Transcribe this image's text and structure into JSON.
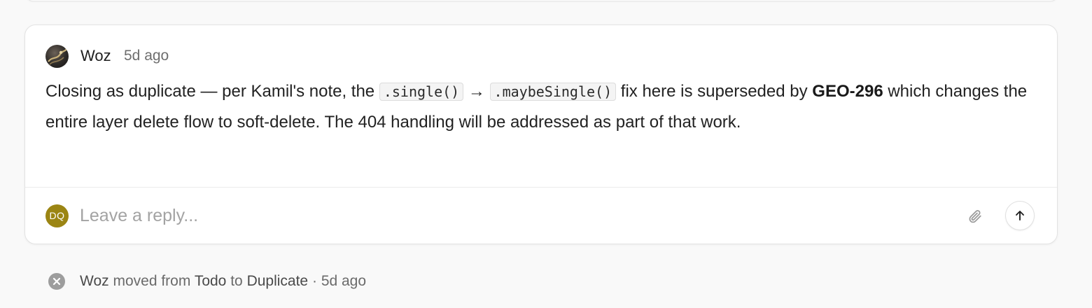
{
  "comment": {
    "author": "Woz",
    "time": "5d ago",
    "body": {
      "text1": "Closing as duplicate — per Kamil's note, the ",
      "code1": ".single()",
      "arrow": " → ",
      "code2": ".maybeSingle()",
      "text2": " fix here is superseded by ",
      "issue": "GEO-296",
      "text3": " which changes the entire layer delete flow to soft-delete. The 404 handling will be addressed as part of that work."
    }
  },
  "reply": {
    "avatar_initials": "DQ",
    "placeholder": "Leave a reply...",
    "attach_icon": "paperclip-icon",
    "send_icon": "arrow-up-icon"
  },
  "activity": {
    "icon": "close-circle-icon",
    "actor": "Woz",
    "action": "moved from",
    "from_status": "Todo",
    "to_word": "to",
    "to_status": "Duplicate",
    "separator": "·",
    "time": "5d ago"
  },
  "colors": {
    "page_bg": "#f9f9f9",
    "card_bg": "#ffffff",
    "reply_avatar_bg": "#9b8513",
    "muted_text": "#6b6b6b"
  }
}
